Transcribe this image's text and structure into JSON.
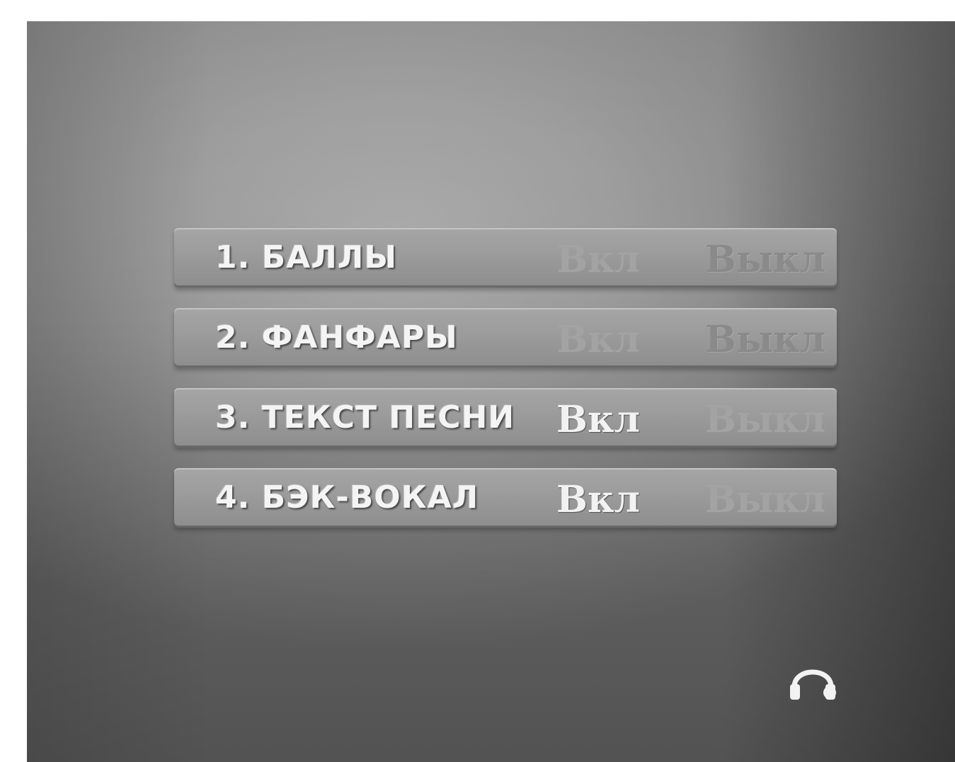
{
  "menu": {
    "items": [
      {
        "label": "1. БАЛЛЫ",
        "on_label": "Вкл",
        "off_label": "Выкл",
        "selected": "off"
      },
      {
        "label": "2. ФАНФАРЫ",
        "on_label": "Вкл",
        "off_label": "Выкл",
        "selected": "off"
      },
      {
        "label": "3. ТЕКСТ ПЕСНИ",
        "on_label": "Вкл",
        "off_label": "Выкл",
        "selected": "on"
      },
      {
        "label": "4. БЭК-ВОКАЛ",
        "on_label": "Вкл",
        "off_label": "Выкл",
        "selected": "on"
      }
    ]
  },
  "status": {
    "icon": "headphone-icon"
  },
  "colors": {
    "active_text": "#f2f2f2",
    "inactive_text": "#a3a3a3",
    "selected_text": "#8a8a8a"
  }
}
